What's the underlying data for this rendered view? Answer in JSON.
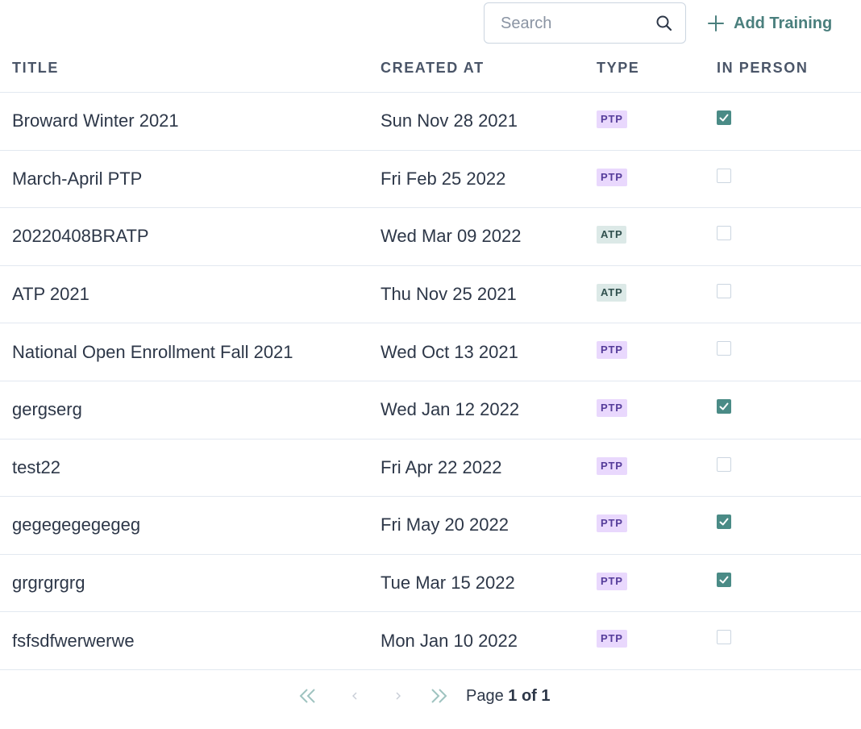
{
  "search": {
    "placeholder": "Search",
    "value": ""
  },
  "toolbar": {
    "add_label": "Add Training"
  },
  "colors": {
    "accent": "#4a7f7d",
    "checkbox_checked": "#4a8b86",
    "ptp_bg": "#e9d8fd",
    "ptp_fg": "#553c9a",
    "atp_bg": "#dce9e7",
    "atp_fg": "#2f4f4d"
  },
  "icons": {
    "search": "search-icon",
    "add": "plus-icon",
    "first": "double-chevron-left-icon",
    "prev": "chevron-left-icon",
    "next": "chevron-right-icon",
    "last": "double-chevron-right-icon"
  },
  "table": {
    "headers": {
      "title": "TITLE",
      "created_at": "CREATED AT",
      "type": "TYPE",
      "in_person": "IN PERSON"
    },
    "rows": [
      {
        "title": "Broward Winter 2021",
        "created_at": "Sun Nov 28 2021",
        "type": "PTP",
        "in_person": true
      },
      {
        "title": "March-April PTP",
        "created_at": "Fri Feb 25 2022",
        "type": "PTP",
        "in_person": false
      },
      {
        "title": "20220408BRATP",
        "created_at": "Wed Mar 09 2022",
        "type": "ATP",
        "in_person": false
      },
      {
        "title": "ATP 2021",
        "created_at": "Thu Nov 25 2021",
        "type": "ATP",
        "in_person": false
      },
      {
        "title": "National Open Enrollment Fall 2021",
        "created_at": "Wed Oct 13 2021",
        "type": "PTP",
        "in_person": false
      },
      {
        "title": "gergserg",
        "created_at": "Wed Jan 12 2022",
        "type": "PTP",
        "in_person": true
      },
      {
        "title": "test22",
        "created_at": "Fri Apr 22 2022",
        "type": "PTP",
        "in_person": false
      },
      {
        "title": "gegegegegegeg",
        "created_at": "Fri May 20 2022",
        "type": "PTP",
        "in_person": true
      },
      {
        "title": "grgrgrgrg",
        "created_at": "Tue Mar 15 2022",
        "type": "PTP",
        "in_person": true
      },
      {
        "title": "fsfsdfwerwerwe",
        "created_at": "Mon Jan 10 2022",
        "type": "PTP",
        "in_person": false
      }
    ]
  },
  "pagination": {
    "prefix": "Page",
    "current_of_total": "1 of 1"
  }
}
